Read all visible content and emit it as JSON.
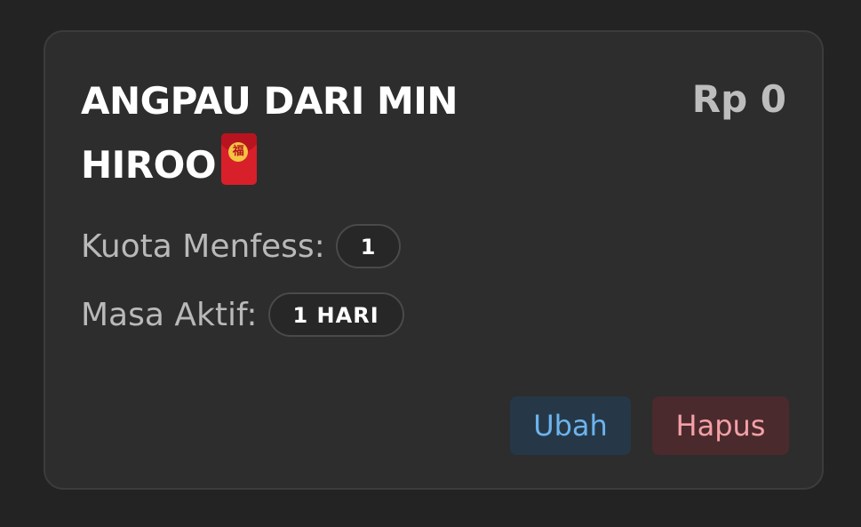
{
  "package": {
    "title": "ANGPAU DARI MIN HIROO",
    "title_icon": "red-envelope-icon",
    "price": "Rp 0",
    "quota_label": "Kuota Menfess:",
    "quota_value": "1",
    "active_label": "Masa Aktif:",
    "active_value": "1 HARI"
  },
  "actions": {
    "edit_label": "Ubah",
    "delete_label": "Hapus"
  },
  "colors": {
    "background": "#232323",
    "card": "#2d2d2d",
    "edit_accent": "#6cb4f0",
    "delete_accent": "#f4a0a6"
  }
}
